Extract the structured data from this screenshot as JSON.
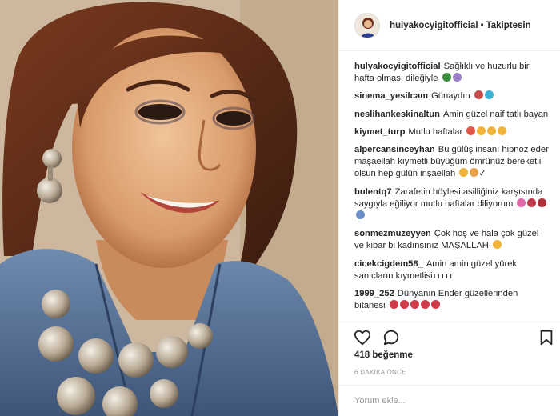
{
  "photo": {
    "alt_icon": "portrait-photo"
  },
  "header": {
    "username": "hulyakocyigitofficial",
    "separator": "•",
    "follow_status": "Takiptesin"
  },
  "comments": [
    {
      "user": "hulyakocyigitofficial",
      "text": "Sağlıklı ve huzurlu bir hafta olması dileğiyle",
      "emojis": [
        "#3a8d3a",
        "#9b7fc9"
      ]
    },
    {
      "user": "sinema_yesilcam",
      "text": "Günaydın",
      "emojis": [
        "#c94a4a",
        "#3bb3d9"
      ]
    },
    {
      "user": "neslihankeskinaltun",
      "text": "Amin güzel naif tatlı bayan",
      "emojis": []
    },
    {
      "user": "kiymet_turp",
      "text": "Mutlu haftalar",
      "emojis": [
        "#f0b43a",
        "#f0b43a",
        "#f0b43a",
        "#f0b43a"
      ]
    },
    {
      "user": "alpercansinceyhan",
      "text": "Bu gülüş insanı hipnoz eder maşaellah kıymetli büyüğüm ömrünüz bereketli olsun hep gülün inşaellah",
      "emojis": [
        "#f0b43a",
        "#e9a04a"
      ]
    },
    {
      "user": "bulentq7",
      "text": "Zarafetin böylesi asilliğiniz karşısında saygıyla eğiliyor mutlu haftalar diliyorum",
      "emojis": [
        "#e06aa8",
        "#c0394a",
        "#b0303a",
        "#6a8fc9"
      ]
    },
    {
      "user": "sonmezmuzeyyen",
      "text": "Çok hoş ve hala çok güzel ve kibar bi kadınsınız MAŞALLAH",
      "emojis": [
        "#f0b43a"
      ]
    },
    {
      "user": "cicekcigdem58_",
      "text": "Amin amin güzel yürek sanıcların kıymetlisiттттт",
      "emojis": []
    },
    {
      "user": "1999_252",
      "text": "Dünyanın Ender güzellerinden bitanesi",
      "emojis": [
        "#d23b4a",
        "#d23b4a",
        "#d23b4a",
        "#d23b4a",
        "#d23b4a"
      ]
    }
  ],
  "actions": {
    "like_icon": "heart-icon",
    "comment_icon": "comment-icon",
    "save_icon": "bookmark-icon"
  },
  "likes": "418 beğenme",
  "timestamp": "6 DAKİKA ÖNCE",
  "comment_box": {
    "placeholder": "Yorum ekle..."
  }
}
